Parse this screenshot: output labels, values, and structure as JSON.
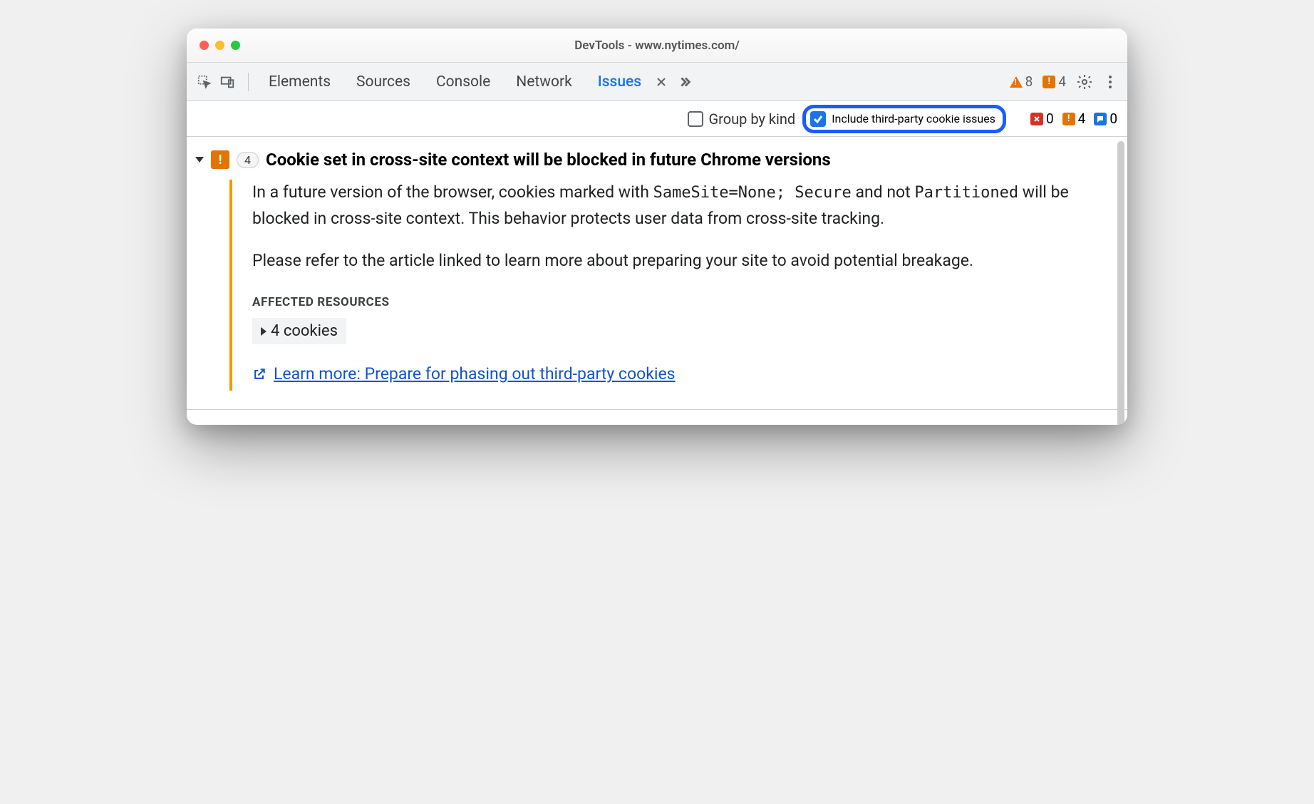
{
  "window": {
    "title": "DevTools - www.nytimes.com/"
  },
  "tabs": {
    "elements": "Elements",
    "sources": "Sources",
    "console": "Console",
    "network": "Network",
    "issues": "Issues"
  },
  "topCounts": {
    "warnings": "8",
    "issues": "4"
  },
  "filters": {
    "groupByKind": {
      "label": "Group by kind",
      "checked": false
    },
    "includeThirdParty": {
      "label": "Include third-party cookie issues",
      "checked": true
    }
  },
  "filterCounts": {
    "errors": "0",
    "warnings": "4",
    "info": "0"
  },
  "issue": {
    "count": "4",
    "title": "Cookie set in cross-site context will be blocked in future Chrome versions",
    "desc1_a": "In a future version of the browser, cookies marked with ",
    "desc1_code1": "SameSite=None; Secure",
    "desc1_b": " and not ",
    "desc1_code2": "Partitioned",
    "desc1_c": " will be blocked in cross-site context. This behavior protects user data from cross-site tracking.",
    "desc2": "Please refer to the article linked to learn more about preparing your site to avoid potential breakage.",
    "affectedHeader": "AFFECTED RESOURCES",
    "cookiesCount": "4 cookies",
    "learnMore": "Learn more: Prepare for phasing out third-party cookies"
  }
}
